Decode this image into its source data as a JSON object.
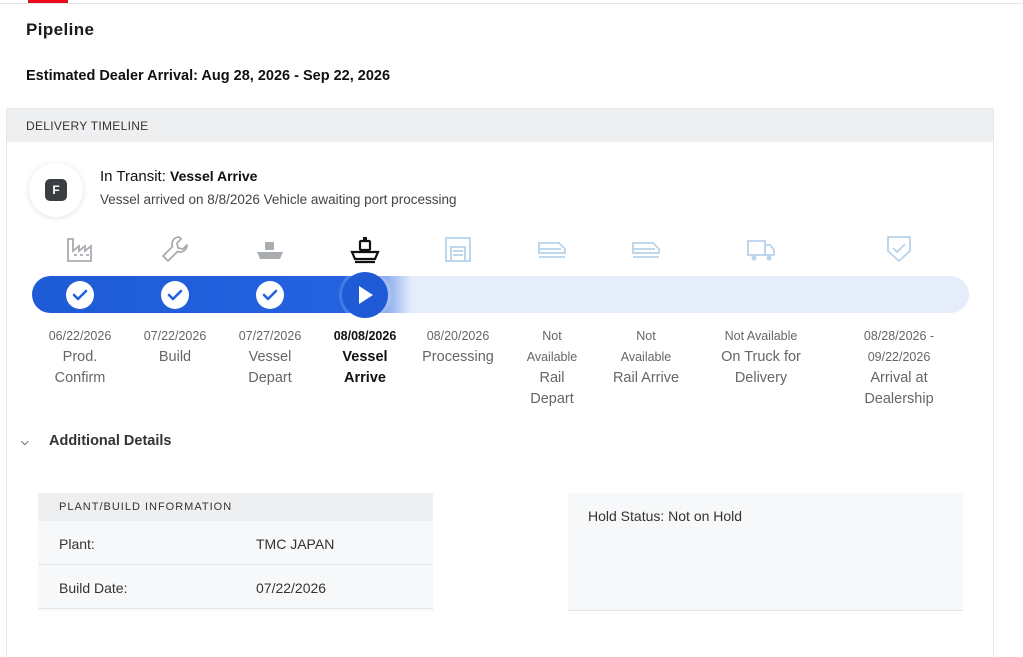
{
  "page": {
    "title": "Pipeline",
    "eta": "Estimated Dealer Arrival: Aug 28, 2026 - Sep 22, 2026"
  },
  "timeline": {
    "header": "DELIVERY TIMELINE",
    "badge_letter": "F",
    "status_prefix": "In Transit:",
    "status_stage": "Vessel Arrive",
    "status_description": "Vessel arrived on 8/8/2026 Vehicle awaiting port processing",
    "progress_color": "#2462e0",
    "steps": [
      {
        "date": "06/22/2026",
        "label": "Prod. Confirm",
        "state": "done",
        "icon": "factory-icon"
      },
      {
        "date": "07/22/2026",
        "label": "Build",
        "state": "done",
        "icon": "wrench-icon"
      },
      {
        "date": "07/27/2026",
        "label": "Vessel Depart",
        "state": "done",
        "icon": "ship-icon"
      },
      {
        "date": "08/08/2026",
        "label": "Vessel Arrive",
        "state": "current",
        "icon": "ship-icon"
      },
      {
        "date": "08/20/2026",
        "label": "Processing",
        "state": "pending",
        "icon": "garage-icon"
      },
      {
        "date": "Not Available",
        "label": "Rail Depart",
        "state": "pending",
        "icon": "train-icon"
      },
      {
        "date": "Not Available",
        "label": "Rail Arrive",
        "state": "pending",
        "icon": "train-icon"
      },
      {
        "date": "Not Available",
        "label": "On Truck for Delivery",
        "state": "pending",
        "icon": "truck-icon"
      },
      {
        "date": "08/28/2026 - 09/22/2026",
        "label": "Arrival at Dealership",
        "state": "pending",
        "icon": "shield-check-icon"
      }
    ]
  },
  "details": {
    "toggle_label": "Additional Details",
    "plant_card": {
      "header": "PLANT/BUILD INFORMATION",
      "rows": [
        {
          "key": "Plant:",
          "value": "TMC JAPAN"
        },
        {
          "key": "Build Date:",
          "value": "07/22/2026"
        }
      ]
    },
    "hold_status": "Hold Status: Not on Hold"
  }
}
